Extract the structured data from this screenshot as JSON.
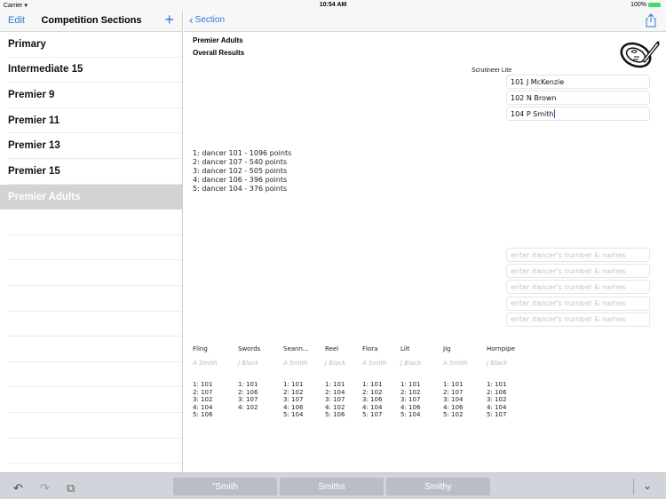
{
  "status_bar": {
    "carrier": "Carrier",
    "wifi_icon": "wifi-icon",
    "time": "10:54 AM",
    "battery": "100%",
    "battery_icon": "battery-icon"
  },
  "sidebar": {
    "edit_label": "Edit",
    "title": "Competition Sections",
    "add_icon": "plus-icon",
    "items": [
      {
        "label": "Primary",
        "selected": false
      },
      {
        "label": "Intermediate 15",
        "selected": false
      },
      {
        "label": "Premier 9",
        "selected": false
      },
      {
        "label": "Premier 11",
        "selected": false
      },
      {
        "label": "Premier 13",
        "selected": false
      },
      {
        "label": "Premier 15",
        "selected": false
      },
      {
        "label": "Premier Adults",
        "selected": true
      }
    ]
  },
  "detail": {
    "back_label": "Section",
    "share_icon": "share-icon",
    "section_title": "Premier Adults",
    "overall_title": "Overall Results",
    "app_name": "Scrutineer Lite",
    "logo_icon": "scrutineer-logo-icon",
    "judge_fields": [
      "101 J McKenzie",
      "102 N Brown",
      "104 P Smith"
    ],
    "placeholder": "enter dancer's number & names",
    "overall_results": [
      "1: dancer 101 - 1096 points",
      "2: dancer 107 - 540 points",
      "3: dancer 102 - 505 points",
      "4: dancer 106 - 396 points",
      "5: dancer 104 - 376 points"
    ],
    "dances": [
      {
        "name": "Fling",
        "judge": "A Smith",
        "places": [
          "1: 101",
          "2: 107",
          "3: 102",
          "4: 104",
          "5: 106"
        ]
      },
      {
        "name": "Swords",
        "judge": "J Black",
        "places": [
          "1: 101",
          "2: 106",
          "3: 107",
          "4: 102"
        ]
      },
      {
        "name": "Seann...",
        "judge": "A Smith",
        "places": [
          "1: 101",
          "2: 102",
          "3: 107",
          "4: 106",
          "5: 104"
        ]
      },
      {
        "name": "Reel",
        "judge": "J Black",
        "places": [
          "1: 101",
          "2: 104",
          "3: 107",
          "4: 102",
          "5: 106"
        ]
      },
      {
        "name": "Flora",
        "judge": "A Smith",
        "places": [
          "1: 101",
          "2: 102",
          "3: 106",
          "4: 104",
          "5: 107"
        ]
      },
      {
        "name": "Lilt",
        "judge": "J Black",
        "places": [
          "1: 101",
          "2: 102",
          "3: 107",
          "4: 106",
          "5: 104"
        ]
      },
      {
        "name": "Jig",
        "judge": "A Smith",
        "places": [
          "1: 101",
          "2: 107",
          "3: 104",
          "4: 106",
          "5: 102"
        ]
      },
      {
        "name": "Hornpipe",
        "judge": "J Black",
        "places": [
          "1: 101",
          "2: 106",
          "3: 102",
          "4: 104",
          "5: 107"
        ]
      }
    ]
  },
  "keyboard_bar": {
    "suggestions": [
      "\"Smith",
      "Smiths",
      "Smithy"
    ],
    "undo_icon": "undo-icon",
    "redo_icon": "redo-icon",
    "paste_icon": "paste-icon",
    "dismiss_icon": "chevron-down-icon"
  }
}
